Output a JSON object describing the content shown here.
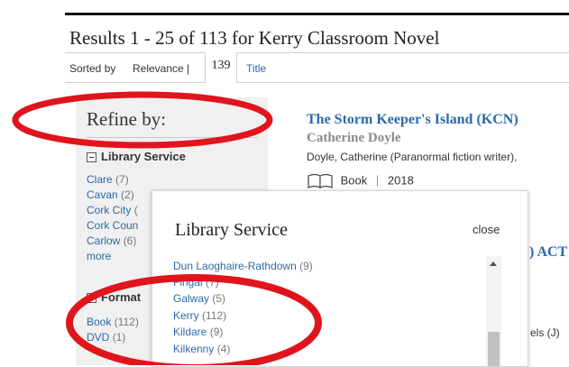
{
  "results": {
    "title": "Results 1 - 25 of 113 for Kerry Classroom Novel",
    "sorted_by": "Sorted by",
    "sort_relevance": "Relevance |",
    "sort_title": "Title",
    "overlay_number": "139"
  },
  "refine": {
    "heading": "Refine by:",
    "library_service_heading": "Library Service",
    "library_items": [
      {
        "name": "Clare",
        "count": "(7)"
      },
      {
        "name": "Cavan",
        "count": "(2)"
      },
      {
        "name": "Cork City",
        "count": "("
      },
      {
        "name": "Cork Coun",
        "count": ""
      },
      {
        "name": "Carlow",
        "count": "(6)"
      },
      {
        "name": "more",
        "count": ""
      }
    ],
    "format_heading": "Format",
    "format_items": [
      {
        "name": "Book",
        "count": "(112)"
      },
      {
        "name": "DVD",
        "count": "(1)"
      }
    ]
  },
  "result1": {
    "title": "The Storm Keeper's Island (KCN)",
    "author": "Catherine Doyle",
    "meta": "Doyle, Catherine (Paranormal fiction writer),",
    "format": "Book",
    "separator": "|",
    "year": "2018"
  },
  "result2": {
    "title_fragment": ") ACT",
    "meta_fragment": "els (J)"
  },
  "modal": {
    "title": "Library Service",
    "close": "close",
    "items": [
      {
        "name": "Dun Laoghaire-Rathdown",
        "count": "(9)"
      },
      {
        "name": "Fingal",
        "count": "(7)"
      },
      {
        "name": "Galway",
        "count": "(5)"
      },
      {
        "name": "Kerry",
        "count": "(112)"
      },
      {
        "name": "Kildare",
        "count": "(9)"
      },
      {
        "name": "Kilkenny",
        "count": "(4)"
      }
    ]
  },
  "annotations": {
    "ellipse_color": "#e0141c"
  },
  "colors": {
    "link": "#2c6aa8",
    "panel": "#f0f0f0",
    "muted": "#8a8a8a"
  },
  "icons": {
    "format": "book-icon",
    "collapse": "minus-box-icon",
    "scroll": "scroll-up-arrow-icon"
  }
}
